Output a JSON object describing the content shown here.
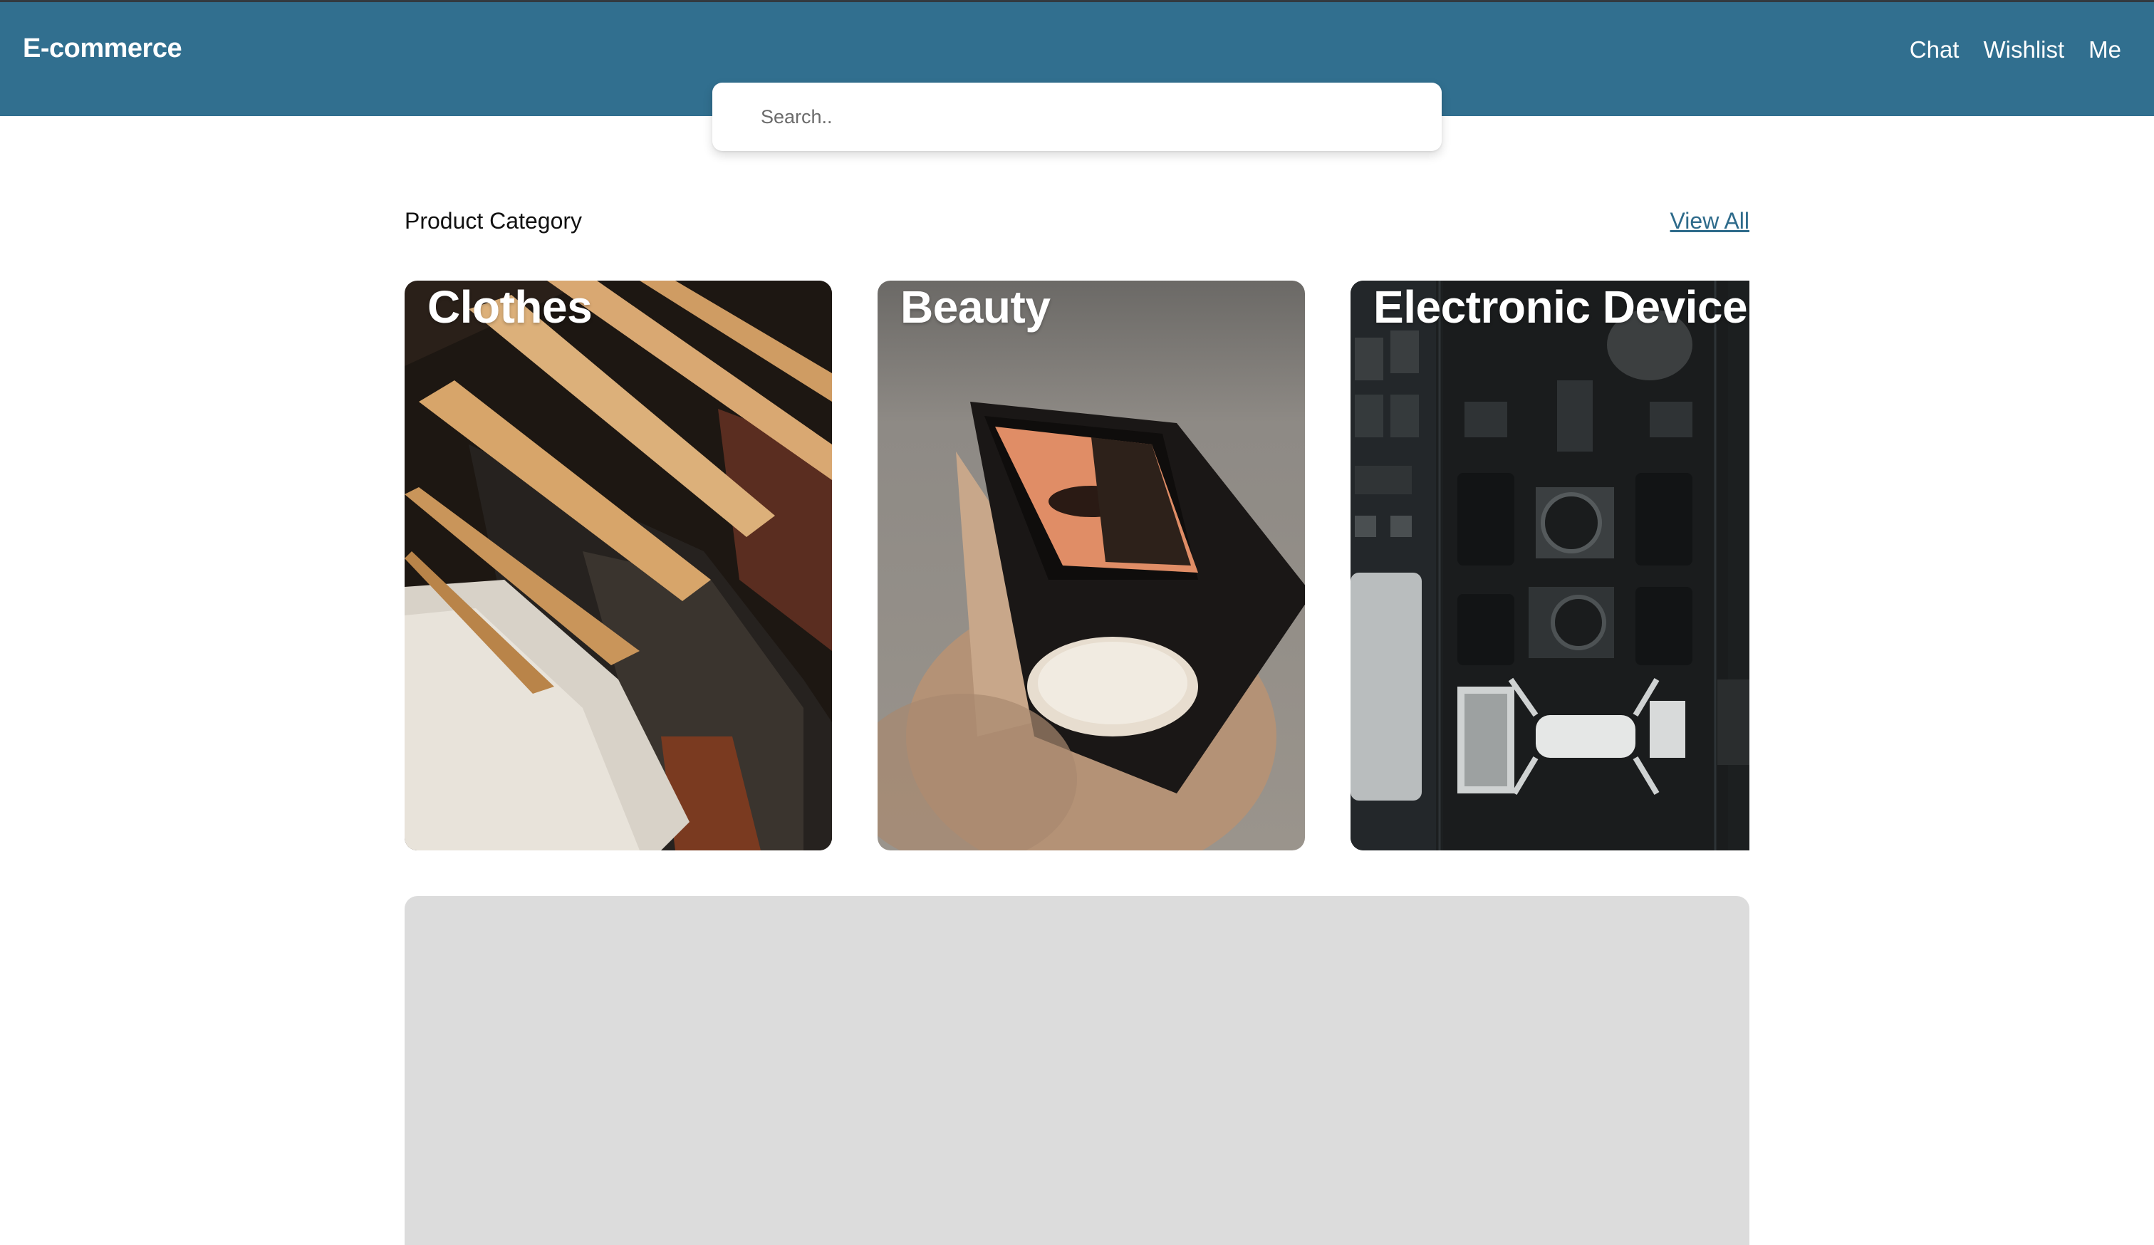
{
  "header": {
    "brand": "E-commerce",
    "nav": [
      "Chat",
      "Wishlist",
      "Me"
    ],
    "background_color": "#316f8f"
  },
  "search": {
    "placeholder": "Search..",
    "value": ""
  },
  "category_section": {
    "title": "Product Category",
    "view_all_label": "View All",
    "categories": [
      {
        "label": "Clothes",
        "image": "clothes-on-wooden-hangers-photo"
      },
      {
        "label": "Beauty",
        "image": "compact-mirror-reflection-photo"
      },
      {
        "label": "Electronic Device",
        "image": "cameras-and-drone-flatlay-photo"
      }
    ]
  },
  "banner": {
    "state": "loading-placeholder",
    "background_color": "#dcdcdc"
  }
}
